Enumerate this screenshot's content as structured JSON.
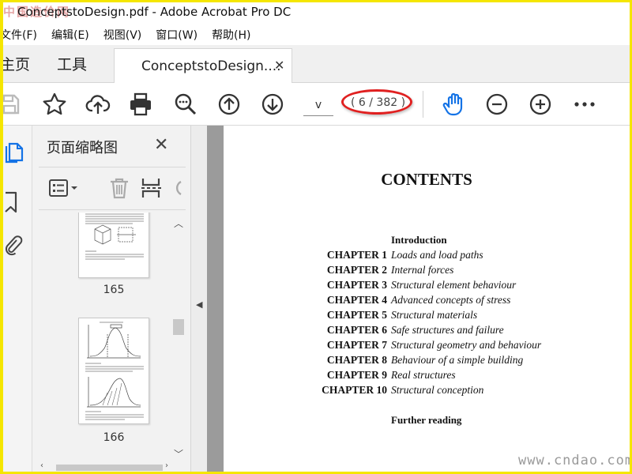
{
  "window": {
    "title": "ConceptstoDesign.pdf - Adobe Acrobat Pro DC",
    "watermark_top": "中国造价网"
  },
  "menu": [
    "文件(F)",
    "编辑(E)",
    "视图(V)",
    "窗口(W)",
    "帮助(H)"
  ],
  "tabs": {
    "home": "主页",
    "tools": "工具",
    "document": "ConceptstoDesign....",
    "close_glyph": "✕"
  },
  "toolbar": {
    "page_input": "v",
    "page_count": "( 6 / 382 )",
    "icons": [
      "save-icon",
      "star-icon",
      "upload-icon",
      "print-icon",
      "zoom-search-icon",
      "page-up-icon",
      "page-down-icon",
      "hand-icon",
      "zoom-out-icon",
      "zoom-in-icon",
      "more-icon"
    ]
  },
  "rail": {
    "icons": [
      "pages-icon",
      "bookmark-icon",
      "attachment-icon"
    ]
  },
  "thumbnail_panel": {
    "title": "页面缩略图",
    "close_glyph": "✕",
    "thumbnails": [
      {
        "label": "165"
      },
      {
        "label": "166"
      }
    ]
  },
  "document": {
    "heading": "CONTENTS",
    "introduction": "Introduction",
    "chapters": [
      {
        "number": "CHAPTER 1",
        "title": "Loads and load paths"
      },
      {
        "number": "CHAPTER 2",
        "title": "Internal forces"
      },
      {
        "number": "CHAPTER 3",
        "title": "Structural element behaviour"
      },
      {
        "number": "CHAPTER 4",
        "title": "Advanced concepts of stress"
      },
      {
        "number": "CHAPTER 5",
        "title": "Structural materials"
      },
      {
        "number": "CHAPTER 6",
        "title": "Safe structures and failure"
      },
      {
        "number": "CHAPTER 7",
        "title": "Structural geometry and behaviour"
      },
      {
        "number": "CHAPTER 8",
        "title": "Behaviour of a simple building"
      },
      {
        "number": "CHAPTER 9",
        "title": "Real structures"
      },
      {
        "number": "CHAPTER 10",
        "title": "Structural conception"
      }
    ],
    "further_reading": "Further reading"
  },
  "watermark_bottom": "www.cndao.com",
  "colors": {
    "accent": "#1473e6",
    "highlight_ellipse": "#e02020",
    "frame": "#f5e600"
  }
}
